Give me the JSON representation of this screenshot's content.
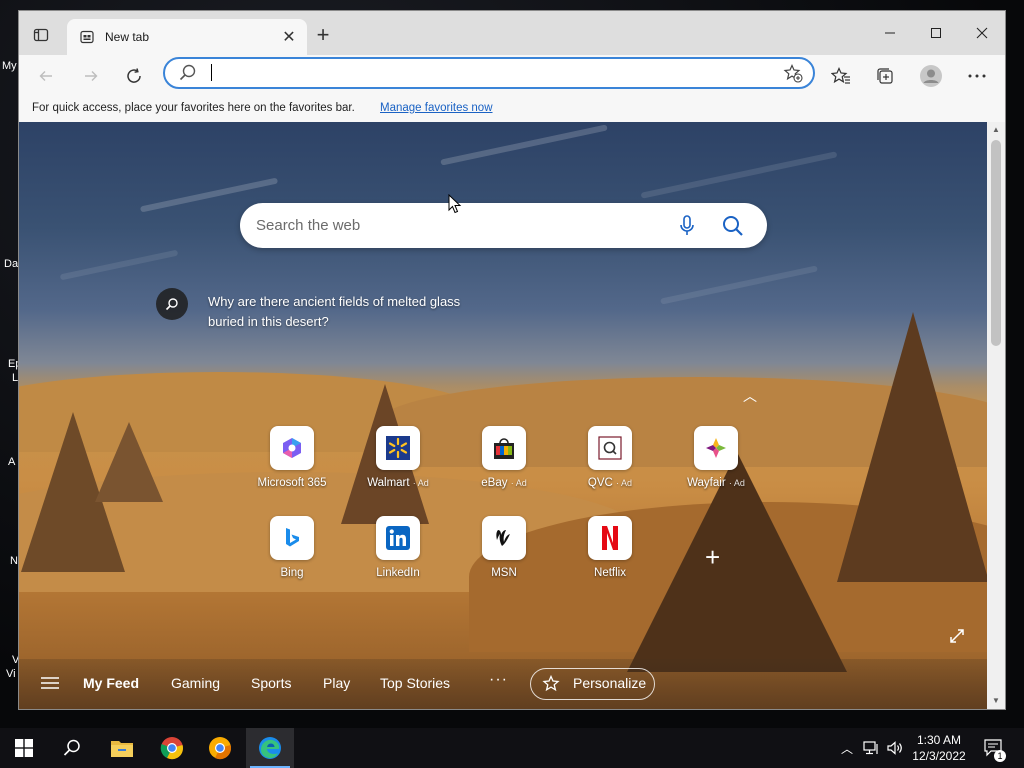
{
  "desktop": {
    "icon_labels": [
      "My",
      "Da",
      "Ep",
      "L",
      "A",
      "N",
      "V",
      "Vi"
    ]
  },
  "browser": {
    "tab": {
      "title": "New tab",
      "close_icon": "close-icon",
      "favicon": "new-tab-icon"
    },
    "new_tab_button": "+",
    "window_controls": [
      "minimize-icon",
      "maximize-icon",
      "close-icon"
    ],
    "address": {
      "value": "",
      "placeholder": ""
    },
    "favorites_bar": {
      "message": "For quick access, place your favorites here on the favorites bar.",
      "link": "Manage favorites now"
    }
  },
  "newtab": {
    "search": {
      "placeholder": "Search the web"
    },
    "prompt": "Why are there ancient fields of melted glass buried in this desert?",
    "tiles": [
      {
        "label": "Microsoft 365",
        "ad": "",
        "icon": "microsoft-365-icon",
        "color": "#7b5ef2"
      },
      {
        "label": "Walmart",
        "ad": "· Ad",
        "icon": "walmart-icon",
        "color": "#1b3a8c"
      },
      {
        "label": "eBay",
        "ad": "· Ad",
        "icon": "ebay-icon",
        "color": "#e53238"
      },
      {
        "label": "QVC",
        "ad": "· Ad",
        "icon": "qvc-icon",
        "color": "#7a1b2c"
      },
      {
        "label": "Wayfair",
        "ad": "· Ad",
        "icon": "wayfair-icon",
        "color": "#7f187f"
      },
      {
        "label": "Bing",
        "ad": "",
        "icon": "bing-icon",
        "color": "#1a8ceb"
      },
      {
        "label": "LinkedIn",
        "ad": "",
        "icon": "linkedin-icon",
        "color": "#0a66c2"
      },
      {
        "label": "MSN",
        "ad": "",
        "icon": "msn-icon",
        "color": "#111111"
      },
      {
        "label": "Netflix",
        "ad": "",
        "icon": "netflix-icon",
        "color": "#e50914"
      }
    ],
    "feed": {
      "items": [
        "My Feed",
        "Gaming",
        "Sports",
        "Play",
        "Top Stories"
      ],
      "active": "My Feed",
      "more": "···",
      "personalize": "Personalize"
    }
  },
  "taskbar": {
    "apps": [
      "windows-start-icon",
      "search-icon",
      "file-explorer-icon",
      "chrome-icon",
      "chrome-canary-icon",
      "edge-icon"
    ],
    "active_app": "edge-icon",
    "clock": {
      "time": "1:30 AM",
      "date": "12/3/2022"
    },
    "notification_count": "1"
  }
}
